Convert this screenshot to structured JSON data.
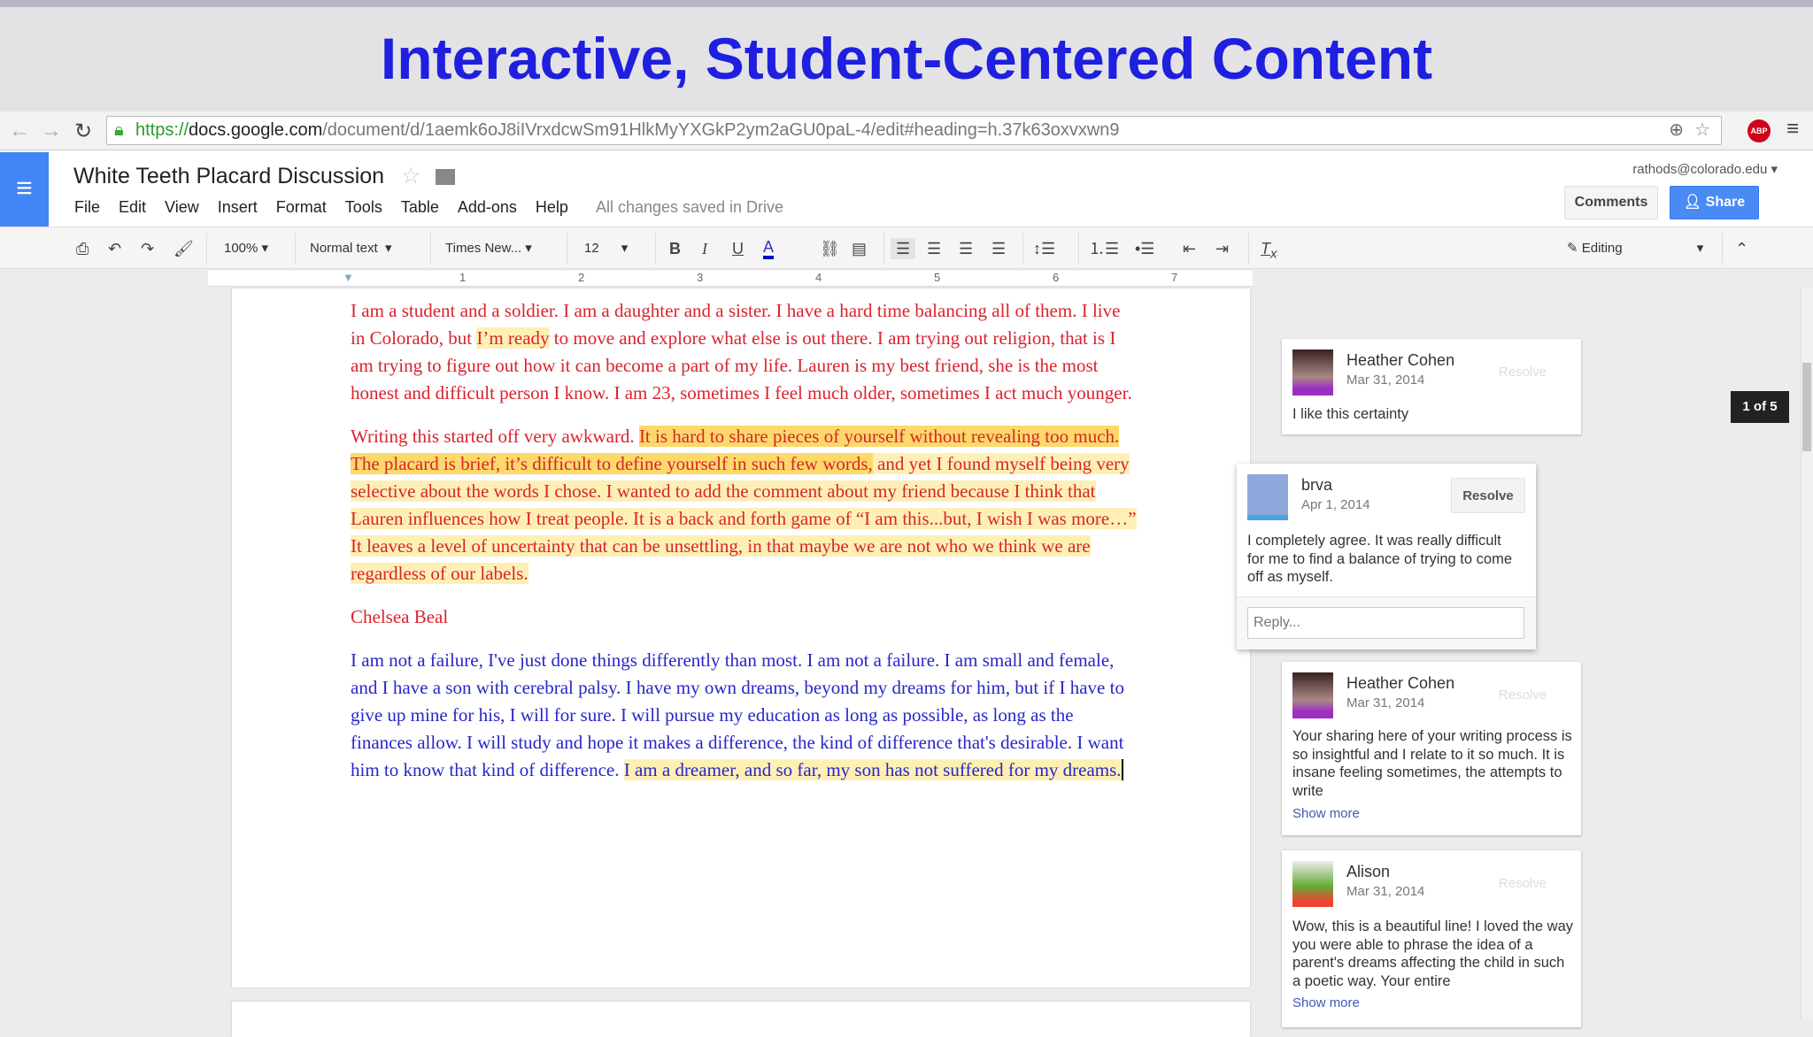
{
  "slide_title": "Interactive, Student-Centered Content",
  "browser": {
    "url_scheme": "https://",
    "url_host": "docs.google.com",
    "url_path": "/document/d/1aemk6oJ8iIVrxdcwSm91HlkMyYXGkP2ym2aGU0paL-4/edit#heading=h.37k63oxvxwn9",
    "adblock": "ABP"
  },
  "doc_header": {
    "title": "White Teeth Placard Discussion",
    "menu": [
      "File",
      "Edit",
      "View",
      "Insert",
      "Format",
      "Tools",
      "Table",
      "Add-ons",
      "Help"
    ],
    "saved_status": "All changes saved in Drive",
    "account": "rathods@colorado.edu",
    "comments_label": "Comments",
    "share_label": "Share"
  },
  "toolbar": {
    "zoom": "100%",
    "style": "Normal text",
    "font": "Times New...",
    "size": "12",
    "mode": "Editing"
  },
  "ruler": [
    "1",
    "2",
    "3",
    "4",
    "5",
    "6",
    "7"
  ],
  "document": {
    "p1": {
      "a": "I am a student and a soldier.  I am a daughter and a sister. I have a hard time balancing all of them.  I live in Colorado, but ",
      "hl": "I’m ready",
      "b": " to move and explore what else is out there.  I am trying out religion, that is I am trying to figure out how it can become a part of my life.  Lauren is my best friend, she is the most honest and difficult person I know.  I am 23, sometimes I feel much older, sometimes I act much younger."
    },
    "p2": {
      "a": "Writing this started off very awkward. ",
      "hl_strong": "It is hard to share pieces of yourself without revealing too much.  The placard is brief, it’s difficult to define yourself in such few words,",
      "hl": " and yet I found myself being very selective about the words I chose.  I wanted to add the comment about my friend because I think that Lauren influences how I treat people.  It is a back and forth game of “I am this...but, I wish I was more…”  It leaves a level of uncertainty that can be unsettling, in that maybe we are not who we think we are regardless of our labels."
    },
    "author": "Chelsea Beal",
    "p3": {
      "a": "I am not a failure, I've just done things differently than most.  I am not a failure.  I am small and female, and I have a son with cerebral palsy.  I have my own dreams, beyond my dreams for him, but if I have to give up mine for his, I will for sure.  I will pursue my education as long as possible, as long as the finances allow.  I will study and hope it makes a difference, the kind of difference that's desirable.  I want him to know that kind of difference. ",
      "hl": "I am a dreamer, and so far, my son has not suffered for my dreams."
    }
  },
  "comments": [
    {
      "name": "Heather Cohen",
      "date": "Mar 31, 2014",
      "text": "I like this certainty",
      "resolve": "Resolve"
    },
    {
      "name": "brva",
      "date": "Apr 1, 2014",
      "text": "I completely agree. It was really difficult for me to find a balance of trying to come off as myself.",
      "resolve": "Resolve",
      "reply_placeholder": "Reply..."
    },
    {
      "name": "Heather Cohen",
      "date": "Mar 31, 2014",
      "text": "Your sharing here of your writing process is so insightful and I relate to it so much. It is insane feeling sometimes, the attempts to write",
      "resolve": "Resolve",
      "more": "Show more"
    },
    {
      "name": "Alison",
      "date": "Mar 31, 2014",
      "text": "Wow, this is a beautiful line! I loved the way you were able to phrase the idea of a parent's dreams affecting the child in such a poetic way. Your entire",
      "resolve": "Resolve",
      "more": "Show more"
    }
  ],
  "comment_counter": "1 of 5"
}
